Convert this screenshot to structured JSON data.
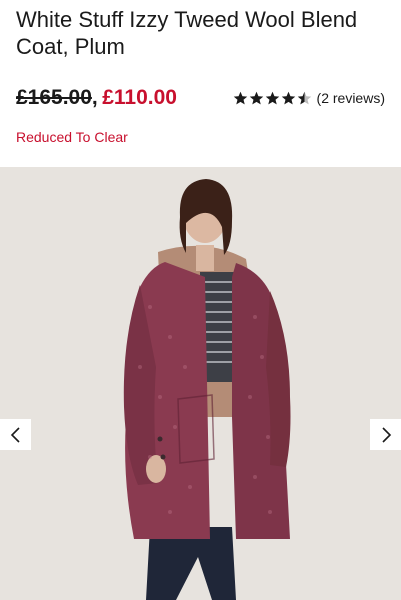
{
  "product": {
    "title": "White Stuff Izzy Tweed Wool Blend Coat, Plum",
    "price_original": "£165.00",
    "price_separator": ",",
    "price_current": "£110.00",
    "promo": "Reduced To Clear",
    "rating": {
      "stars": 4.5,
      "max": 5,
      "reviews_text": "(2 reviews)"
    }
  },
  "gallery": {
    "image_subject": "model wearing plum tweed coat",
    "prev_icon": "chevron-left-icon",
    "next_icon": "chevron-right-icon"
  },
  "colors": {
    "sale_red": "#c8102e",
    "text": "#1a1a1a",
    "coat_plum": "#8a3a50"
  }
}
